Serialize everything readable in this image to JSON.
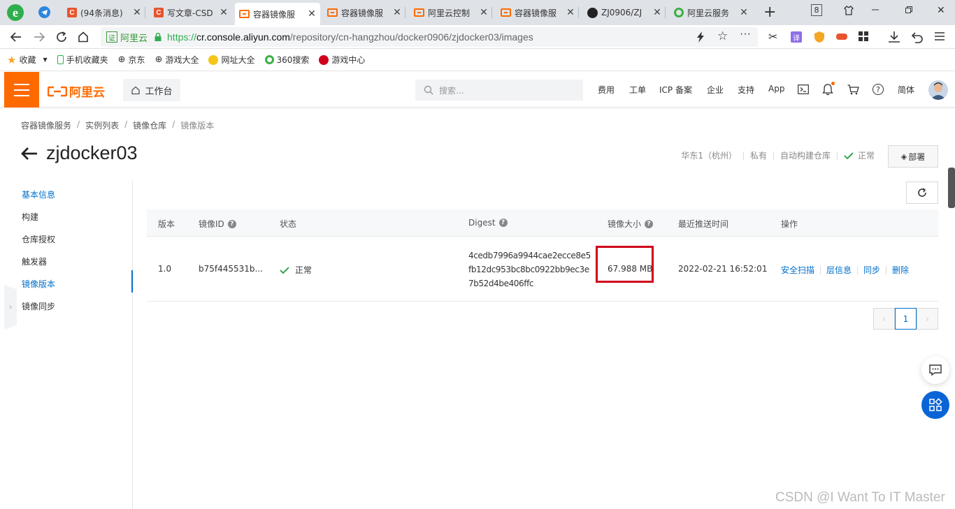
{
  "browser": {
    "tabs": [
      {
        "title": "(94条消息)",
        "icon": "csdn-icon"
      },
      {
        "title": "写文章-CSD",
        "icon": "csdn-icon"
      },
      {
        "title": "容器镜像服",
        "icon": "aliyun-icon"
      },
      {
        "title": "容器镜像服",
        "icon": "aliyun-icon"
      },
      {
        "title": "阿里云控制",
        "icon": "aliyun-icon"
      },
      {
        "title": "容器镜像服",
        "icon": "aliyun-icon"
      },
      {
        "title": "ZJ0906/ZJ",
        "icon": "github-icon"
      },
      {
        "title": "阿里云服务",
        "icon": "search-360-icon"
      }
    ],
    "tab_count": "8",
    "cert_label": "证",
    "site_name": "阿里云",
    "url_scheme": "https://",
    "url_host": "cr.console.aliyun.com",
    "url_path": "/repository/cn-hangzhou/docker0906/zjdocker03/images",
    "bookmarks": [
      "收藏",
      "手机收藏夹",
      "京东",
      "游戏大全",
      "网址大全",
      "360搜索",
      "游戏中心"
    ]
  },
  "console": {
    "logo_text": "阿里云",
    "workbench_label": "工作台",
    "search_placeholder": "搜索...",
    "nav": [
      "费用",
      "工单",
      "ICP 备案",
      "企业",
      "支持",
      "App"
    ],
    "lang": "简体",
    "accent_color": "#ff6a00"
  },
  "breadcrumb": [
    "容器镜像服务",
    "实例列表",
    "镜像仓库",
    "镜像版本"
  ],
  "page": {
    "title": "zjdocker03",
    "meta": {
      "region": "华东1（杭州）",
      "visibility": "私有",
      "build_type": "自动构建仓库",
      "status": "正常"
    },
    "deploy_label": "部署"
  },
  "sidebar": {
    "items": [
      "基本信息",
      "构建",
      "仓库授权",
      "触发器",
      "镜像版本",
      "镜像同步"
    ],
    "active_index": 4,
    "link_color": "#0070cc"
  },
  "table": {
    "headers": {
      "version": "版本",
      "image_id": "镜像ID",
      "status": "状态",
      "digest": "Digest",
      "size": "镜像大小",
      "pushed": "最近推送时间",
      "actions": "操作"
    },
    "rows": [
      {
        "version": "1.0",
        "image_id": "b75f445531b...",
        "status": "正常",
        "digest_lines": [
          "4cedb7996a9944cae2ecce8e5",
          "fb12dc953bc8bc0922bb9ec3e",
          "7b52d4be406ffc"
        ],
        "size": "67.988 MB",
        "pushed": "2022-02-21 16:52:01",
        "actions": [
          "安全扫描",
          "层信息",
          "同步",
          "删除"
        ]
      }
    ]
  },
  "pagination": {
    "current": "1"
  },
  "watermark": "CSDN @I Want To IT Master"
}
